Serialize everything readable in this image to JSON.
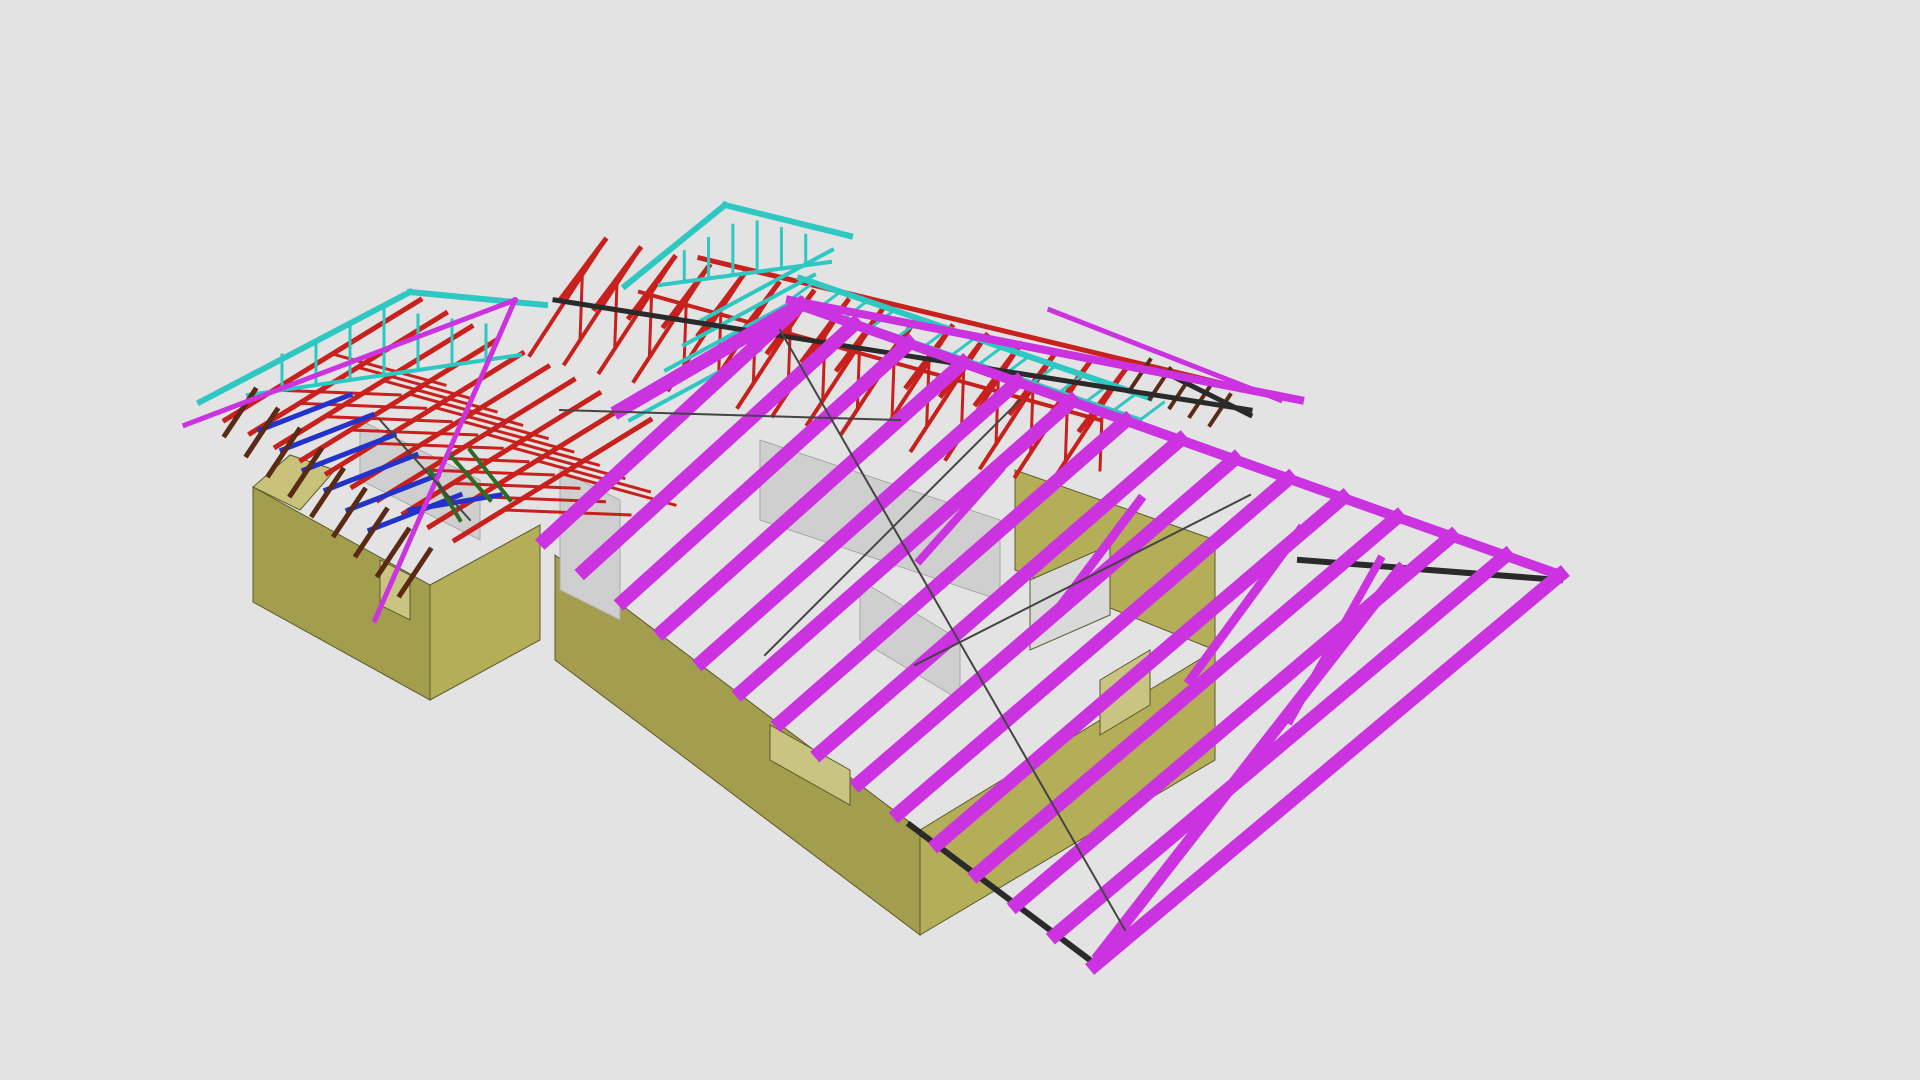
{
  "viewer": {
    "background": "#e3e3e3"
  },
  "model": {
    "colors": {
      "wall_side": "#a29e4e",
      "wall_front": "#b4ae58",
      "wall_top": "#c8c27a",
      "interior_wall": "#cfcfcf",
      "rafter_magenta": "#cc33e0",
      "truss_red": "#c8201c",
      "truss_cyan": "#2ec7c2",
      "blue_member": "#2233cc",
      "brown_member": "#5a2a14",
      "green_member": "#2f6b25",
      "bracing": "#444444",
      "fascia": "#2a2a2a"
    },
    "layers": [
      {
        "name": "walls",
        "icon": "wall-solid"
      },
      {
        "name": "rafters",
        "icon": "rafter-member"
      },
      {
        "name": "trusses",
        "icon": "truss-member"
      },
      {
        "name": "gable-trusses",
        "icon": "gable-truss"
      },
      {
        "name": "bracing",
        "icon": "diagonal-brace"
      }
    ]
  }
}
